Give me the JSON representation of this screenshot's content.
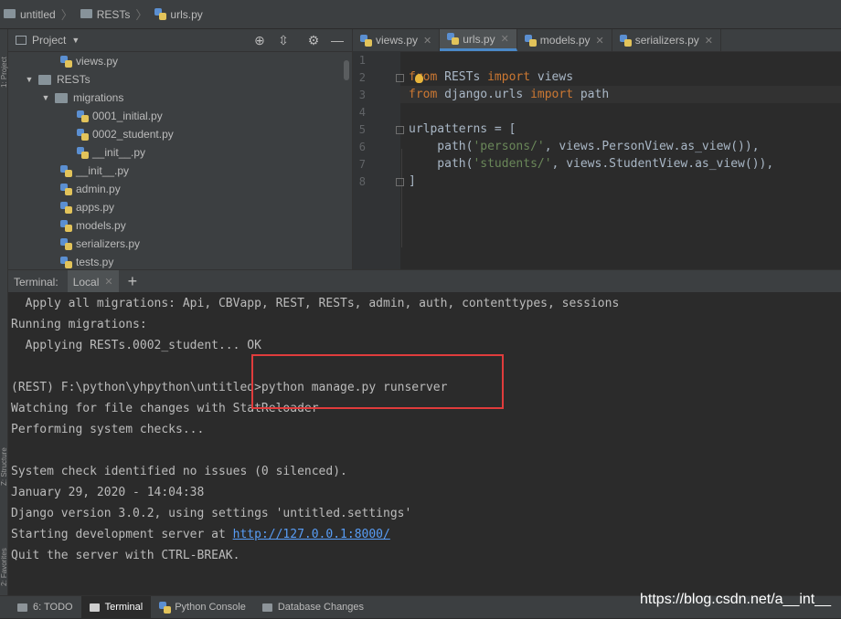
{
  "breadcrumb": [
    "untitled",
    "RESTs",
    "urls.py"
  ],
  "side_strip": {
    "top_label": "1: Project",
    "lower_label": "2: Favorites",
    "mid_label": "Z: Structure"
  },
  "project_panel": {
    "title": "Project",
    "tree": [
      {
        "label": "views.py",
        "kind": "file"
      },
      {
        "label": "RESTs",
        "kind": "folder"
      },
      {
        "label": "migrations",
        "kind": "folder"
      },
      {
        "label": "0001_initial.py",
        "kind": "file"
      },
      {
        "label": "0002_student.py",
        "kind": "file"
      },
      {
        "label": "__init__.py",
        "kind": "file"
      },
      {
        "label": "__init__.py",
        "kind": "file"
      },
      {
        "label": "admin.py",
        "kind": "file"
      },
      {
        "label": "apps.py",
        "kind": "file"
      },
      {
        "label": "models.py",
        "kind": "file"
      },
      {
        "label": "serializers.py",
        "kind": "file"
      },
      {
        "label": "tests.py",
        "kind": "file"
      }
    ]
  },
  "editor": {
    "tabs": [
      {
        "label": "views.py",
        "active": false
      },
      {
        "label": "urls.py",
        "active": true
      },
      {
        "label": "models.py",
        "active": false
      },
      {
        "label": "serializers.py",
        "active": false
      }
    ],
    "line_numbers": [
      "1",
      "2",
      "3",
      "4",
      "5",
      "6",
      "7",
      "8"
    ],
    "code": {
      "l2": {
        "a": "from",
        "b": " RESTs ",
        "c": "import",
        "d": " views"
      },
      "l3": {
        "a": "from",
        "b": " django.urls ",
        "c": "import",
        "d": " path"
      },
      "l5": "urlpatterns = [",
      "l6": {
        "a": "    path(",
        "b": "'persons/'",
        "c": ", views.PersonView.as_view()),"
      },
      "l7": {
        "a": "    path(",
        "b": "'students/'",
        "c": ", views.StudentView.as_view()),"
      },
      "l8": "]"
    }
  },
  "terminal": {
    "label": "Terminal:",
    "tab": "Local",
    "lines": [
      "  Apply all migrations: Api, CBVapp, REST, RESTs, admin, auth, contenttypes, sessions",
      "Running migrations:",
      "  Applying RESTs.0002_student... OK",
      "",
      "(REST) F:\\python\\yhpython\\untitled>python manage.py runserver",
      "Watching for file changes with StatReloader",
      "Performing system checks...",
      "",
      "System check identified no issues (0 silenced).",
      "January 29, 2020 - 14:04:38",
      "Django version 3.0.2, using settings 'untitled.settings'"
    ],
    "server_prefix": "Starting development server at ",
    "server_url": "http://127.0.0.1:8000/",
    "quit_line": "Quit the server with CTRL-BREAK."
  },
  "bottom_bar": {
    "tabs": [
      {
        "label": "6: TODO",
        "active": false
      },
      {
        "label": "Terminal",
        "active": true
      },
      {
        "label": "Python Console",
        "active": false
      },
      {
        "label": "Database Changes",
        "active": false
      }
    ]
  },
  "watermark": "https://blog.csdn.net/a__int__",
  "colors": {
    "highlight_box": "#e03c3c",
    "link": "#589df6",
    "keyword": "#cc7832",
    "string": "#6a8759"
  }
}
